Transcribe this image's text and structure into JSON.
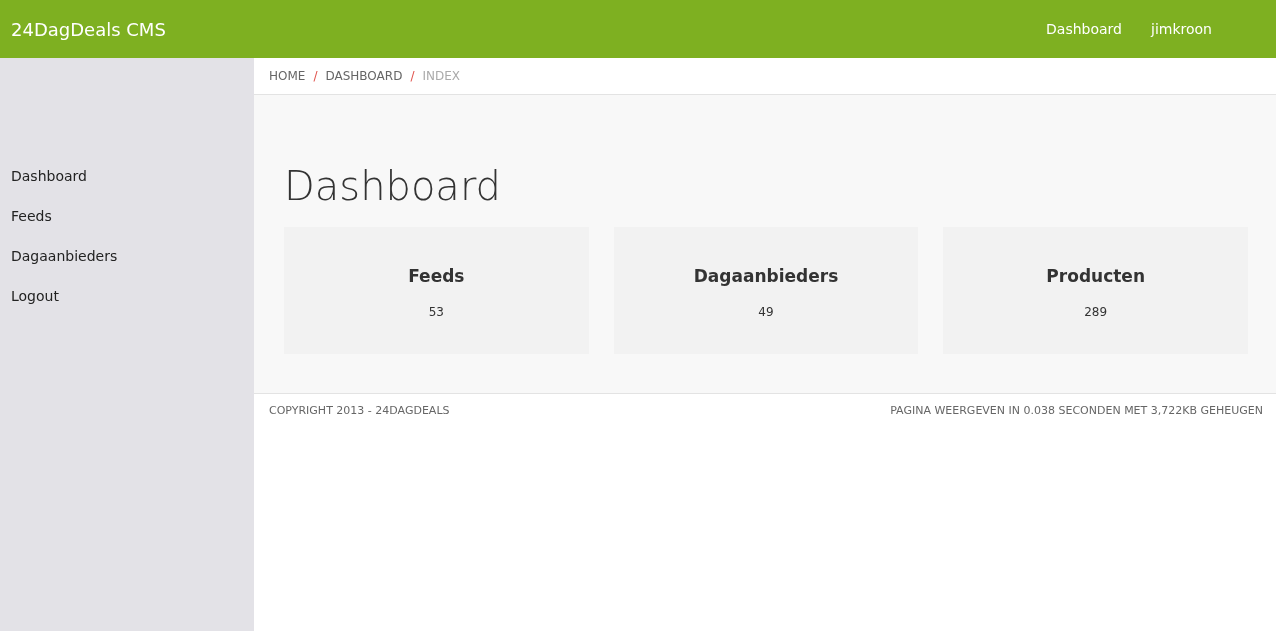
{
  "header": {
    "brand": "24DagDeals CMS",
    "nav": [
      "Dashboard",
      "jimkroon"
    ]
  },
  "sidebar": {
    "items": [
      "Dashboard",
      "Feeds",
      "Dagaanbieders",
      "Logout"
    ]
  },
  "breadcrumb": [
    {
      "label": "HOME",
      "current": false
    },
    {
      "separator": "/",
      "label": "DASHBOARD",
      "current": false
    },
    {
      "separator": "/",
      "label": "INDEX",
      "current": true
    }
  ],
  "page_title": "Dashboard",
  "stats": [
    {
      "title": "Feeds",
      "value": "53"
    },
    {
      "title": "Dagaanbieders",
      "value": "49"
    },
    {
      "title": "Producten",
      "value": "289"
    }
  ],
  "footer": {
    "left": "COPYRIGHT 2013 - 24DAGDEALS",
    "right": "PAGINA WEERGEVEN IN 0.038 SECONDEN MET 3,722KB GEHEUGEN"
  }
}
